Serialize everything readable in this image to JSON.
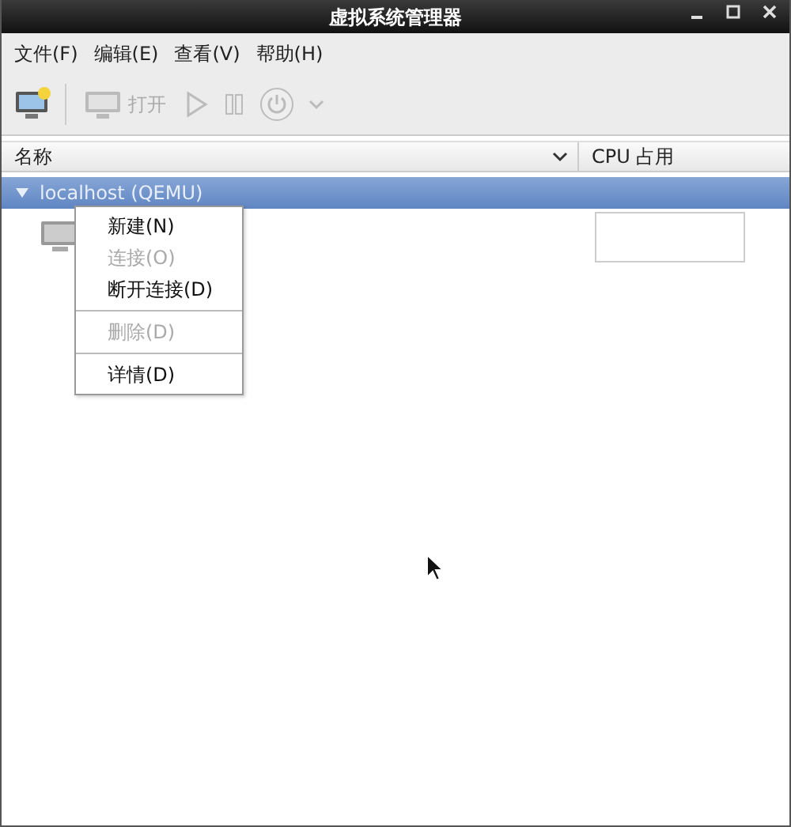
{
  "window": {
    "title": "虚拟系统管理器"
  },
  "menu_bar": [
    {
      "label": "文件(F)"
    },
    {
      "label": "编辑(E)"
    },
    {
      "label": "查看(V)"
    },
    {
      "label": "帮助(H)"
    }
  ],
  "toolbar": [
    {
      "kind": "new",
      "disabled": false
    },
    {
      "kind": "open",
      "label": "打开",
      "disabled": true
    },
    {
      "kind": "run",
      "disabled": true
    },
    {
      "kind": "pause",
      "disabled": true
    },
    {
      "kind": "power",
      "disabled": true
    },
    {
      "kind": "dropdown",
      "disabled": true
    }
  ],
  "table": {
    "columns": [
      {
        "label": "名称"
      },
      {
        "label": "CPU 占用"
      }
    ],
    "rows": [
      {
        "kind": "host",
        "label": "localhost (QEMU)",
        "expanded": true,
        "selected": true
      },
      {
        "kind": "vm",
        "selected": false
      }
    ]
  },
  "context_menu": [
    {
      "kind": "item",
      "label": "新建(N)",
      "disabled": false
    },
    {
      "kind": "item",
      "label": "连接(O)",
      "disabled": true
    },
    {
      "kind": "item",
      "label": "断开连接(D)",
      "disabled": false
    },
    {
      "kind": "separator"
    },
    {
      "kind": "item",
      "label": "删除(D)",
      "disabled": true
    },
    {
      "kind": "separator"
    },
    {
      "kind": "item",
      "label": "详情(D)",
      "disabled": false
    }
  ]
}
